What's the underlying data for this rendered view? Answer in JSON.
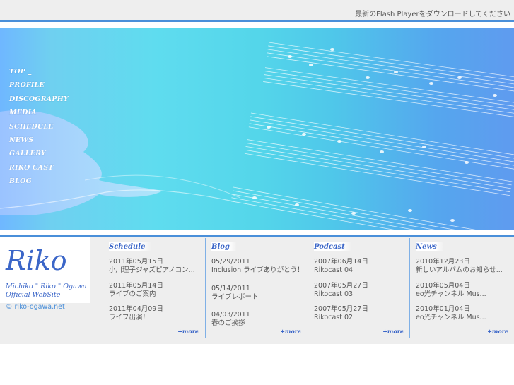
{
  "header": {
    "flash_notice": "最新のFlash Playerをダウンロードしてください"
  },
  "nav": {
    "items": [
      {
        "label": "TOP _"
      },
      {
        "label": "PROFILE"
      },
      {
        "label": "DISCOGRAPHY"
      },
      {
        "label": "MEDIA"
      },
      {
        "label": "SCHEDULE"
      },
      {
        "label": "NEWS"
      },
      {
        "label": "GALLERY"
      },
      {
        "label": "RIKO CAST"
      },
      {
        "label": "BLOG"
      }
    ]
  },
  "logo": {
    "title": "Riko",
    "line1": "Michiko \" Riko \" Ogawa",
    "line2": "Official WebSite"
  },
  "copyright": "© riko-ogawa.net",
  "columns": [
    {
      "title": "Schedule",
      "more": "+more",
      "entries": [
        {
          "date": "2011年05月15日",
          "text": "小川理子ジャズピアノコン..."
        },
        {
          "date": "2011年05月14日",
          "text": "ライブのご案内"
        },
        {
          "date": "2011年04月09日",
          "text": "ライブ出演！"
        }
      ]
    },
    {
      "title": "Blog",
      "more": "+more",
      "entries": [
        {
          "date": "05/29/2011",
          "text": "Inclusion ライブありがとう！"
        },
        {
          "date": "05/14/2011",
          "text": "ライブレポート"
        },
        {
          "date": "04/03/2011",
          "text": "春のご挨拶"
        }
      ]
    },
    {
      "title": "Podcast",
      "more": "+more",
      "entries": [
        {
          "date": "2007年06月14日",
          "text": "Rikocast 04"
        },
        {
          "date": "2007年05月27日",
          "text": "Rikocast 03"
        },
        {
          "date": "2007年05月27日",
          "text": "Rikocast 02"
        }
      ]
    },
    {
      "title": "News",
      "more": "+more",
      "entries": [
        {
          "date": "2010年12月23日",
          "text": "新しいアルバムのお知らせ..."
        },
        {
          "date": "2010年05月04日",
          "text": "eo光チャンネル Mus..."
        },
        {
          "date": "2010年01月04日",
          "text": "eo光チャンネル Mus..."
        }
      ]
    }
  ]
}
